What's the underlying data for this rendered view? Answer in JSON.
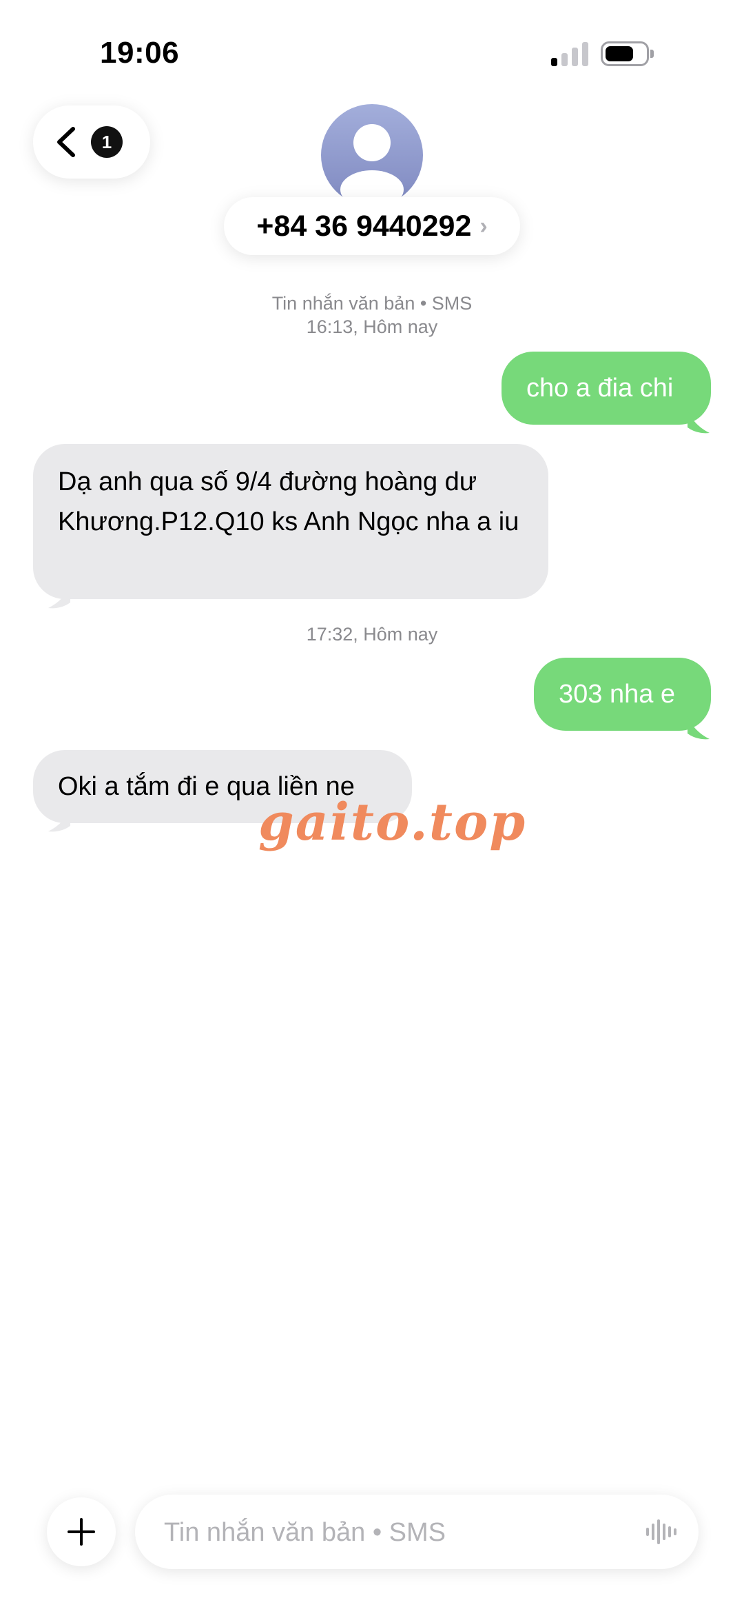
{
  "status_bar": {
    "time": "19:06",
    "signal_icon": "cellular-signal-icon",
    "battery_icon": "battery-icon"
  },
  "header": {
    "back_icon": "chevron-left-icon",
    "unread_count": "1",
    "avatar_icon": "person-avatar-icon",
    "contact_name": "+84 36 9440292",
    "contact_chevron": "›"
  },
  "conversation": {
    "header_line1": "Tin nhắn văn bản • SMS",
    "header_line2": "16:13, Hôm nay",
    "messages": [
      {
        "direction": "outgoing",
        "text": "cho a đia chi"
      },
      {
        "direction": "incoming",
        "text": "Dạ anh qua số 9/4 đường hoàng dư Khương.P12.Q10 ks Anh Ngọc nha a iu"
      },
      {
        "direction": "outgoing",
        "text": "303 nha e"
      },
      {
        "direction": "incoming",
        "text": "Oki a tắm đi e qua liền ne"
      }
    ],
    "timestamp_2": "17:32, Hôm nay"
  },
  "watermark": "gaito.top",
  "composer": {
    "add_icon": "plus-icon",
    "placeholder": "Tin nhắn văn bản • SMS",
    "voice_icon": "audio-waveform-icon"
  },
  "colors": {
    "outgoing_bubble": "#77d97a",
    "incoming_bubble": "#e9e9eb",
    "watermark": "#f08a5d"
  }
}
